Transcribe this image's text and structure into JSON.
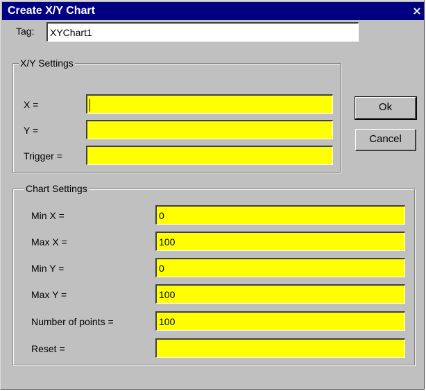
{
  "window": {
    "title": "Create X/Y Chart",
    "close_glyph": "×"
  },
  "tag": {
    "label": "Tag:",
    "value": "XYChart1"
  },
  "xy_settings": {
    "title": "X/Y Settings",
    "x_label": "X =",
    "x_value": "",
    "y_label": "Y =",
    "y_value": "",
    "trigger_label": "Trigger =",
    "trigger_value": ""
  },
  "chart_settings": {
    "title": "Chart Settings",
    "min_x_label": "Min X =",
    "min_x_value": "0",
    "max_x_label": "Max X =",
    "max_x_value": "100",
    "min_y_label": "Min Y =",
    "min_y_value": "0",
    "max_y_label": "Max Y =",
    "max_y_value": "100",
    "points_label": "Number of points =",
    "points_value": "100",
    "reset_label": "Reset =",
    "reset_value": ""
  },
  "buttons": {
    "ok": "Ok",
    "cancel": "Cancel"
  },
  "colors": {
    "field_bg": "#ffff00",
    "titlebar_bg": "#000080",
    "dialog_bg": "#c0c0c0"
  }
}
